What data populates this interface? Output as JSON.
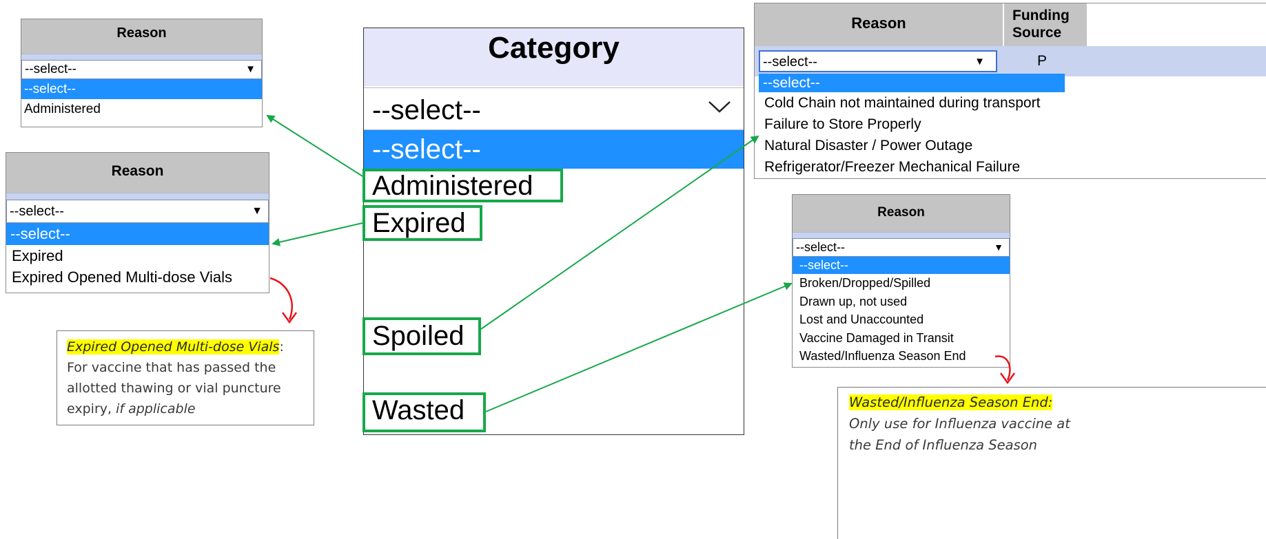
{
  "center": {
    "header": "Category",
    "select_value": "--select--",
    "options": [
      "--select--",
      "Administered",
      "Expired",
      "Spoiled",
      "Wasted"
    ]
  },
  "reason_administered": {
    "header": "Reason",
    "select_value": "--select--",
    "options": [
      "--select--",
      "Administered"
    ]
  },
  "reason_expired": {
    "header": "Reason",
    "select_value": "--select--",
    "options": [
      "--select--",
      "Expired",
      "Expired Opened Multi-dose Vials"
    ]
  },
  "reason_spoiled": {
    "header": "Reason",
    "funding_header": "Funding Source",
    "funding_value": "P",
    "select_value": "--select--",
    "options": [
      "--select--",
      "Cold Chain not maintained during transport",
      "Failure to Store Properly",
      "Natural Disaster / Power Outage",
      "Refrigerator/Freezer Mechanical Failure"
    ]
  },
  "reason_wasted": {
    "header": "Reason",
    "select_value": "--select--",
    "options": [
      "--select--",
      "Broken/Dropped/Spilled",
      "Drawn up, not used",
      "Lost and Unaccounted",
      "Vaccine Damaged in Transit",
      "Wasted/Influenza Season End"
    ]
  },
  "note_expired": {
    "term": "Expired Opened Multi-dose Vials",
    "colon": ":",
    "body": "For vaccine that has passed the allotted thawing or vial puncture expiry,",
    "tail": "if applicable"
  },
  "note_wasted": {
    "term": "Wasted/Influenza Season End:",
    "body": "Only use for Influenza vaccine at the End of Influenza Season"
  },
  "colors": {
    "highlight_blue": "#1e90ff",
    "header_gray": "#c4c4c4",
    "center_header": "#e6e6fa",
    "green": "#17a84a",
    "red": "#e8141b",
    "note_yellow": "#ffff00"
  }
}
